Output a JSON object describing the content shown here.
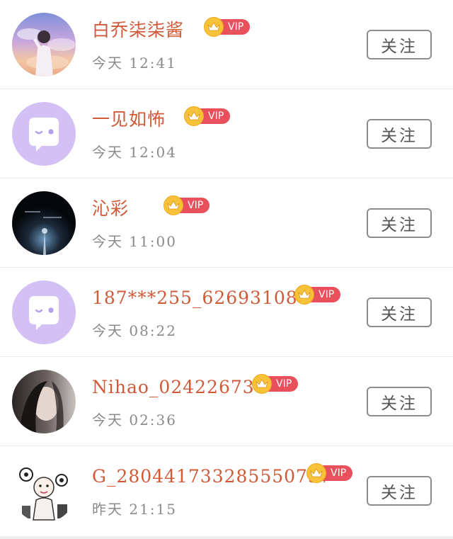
{
  "follow_list": [
    {
      "name": "白乔柒柒酱",
      "time": "今天  12:41",
      "vip": "VIP",
      "follow_label": "关注",
      "avatar_icon": "photo-avatar-sky-girl"
    },
    {
      "name": "一见如怖",
      "time": "今天  12:04",
      "vip": "VIP",
      "follow_label": "关注",
      "avatar_icon": "default-chat-avatar-icon"
    },
    {
      "name": "沁彩",
      "time": "今天  11:00",
      "vip": "VIP",
      "follow_label": "关注",
      "avatar_icon": "photo-avatar-dark-tower"
    },
    {
      "name": "187***255_626931086",
      "time": "今天  08:22",
      "vip": "VIP",
      "follow_label": "关注",
      "avatar_icon": "default-chat-avatar-icon"
    },
    {
      "name": "Nihao_024226737",
      "time": "今天  02:36",
      "vip": "VIP",
      "follow_label": "关注",
      "avatar_icon": "photo-avatar-woman-portrait"
    },
    {
      "name": "G_280441733285550737",
      "time": "昨天  21:15",
      "vip": "VIP",
      "follow_label": "关注",
      "avatar_icon": "photo-avatar-cartoon-sketch"
    }
  ],
  "colors": {
    "name": "#d05a38",
    "time": "#8a8a8a",
    "vip_badge": "#e8505b",
    "crown": "#f6c23a",
    "default_avatar": "#d3c0f5"
  }
}
